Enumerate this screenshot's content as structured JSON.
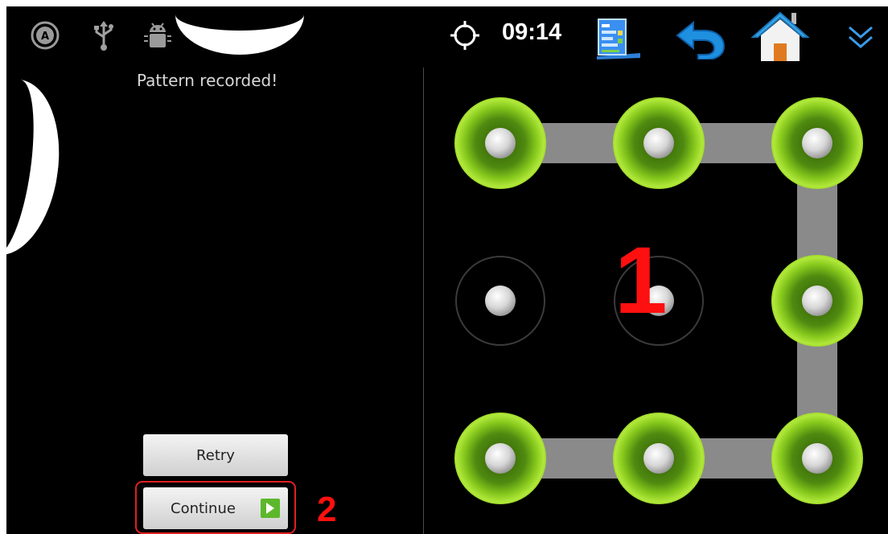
{
  "status_bar": {
    "time": "09:14",
    "icons": [
      "accessibility-icon",
      "usb-icon",
      "android-debug-icon",
      "gps-icon",
      "clock",
      "task-manager-icon",
      "back-icon",
      "home-icon",
      "collapse-icon"
    ]
  },
  "lock_setup": {
    "prompt": "Pattern recorded!",
    "retry_label": "Retry",
    "continue_label": "Continue"
  },
  "pattern": {
    "dots": [
      {
        "id": 1,
        "selected": true
      },
      {
        "id": 2,
        "selected": true
      },
      {
        "id": 3,
        "selected": true
      },
      {
        "id": 4,
        "selected": false
      },
      {
        "id": 5,
        "selected": false
      },
      {
        "id": 6,
        "selected": true
      },
      {
        "id": 7,
        "selected": true
      },
      {
        "id": 8,
        "selected": true
      },
      {
        "id": 9,
        "selected": true
      }
    ],
    "sequence": [
      1,
      2,
      3,
      6,
      9,
      8,
      7
    ]
  },
  "annotations": {
    "step_1": "1",
    "step_2": "2"
  },
  "colors": {
    "background": "#000000",
    "selected_ring": "#7fbf1a",
    "pattern_line": "#8a8a8a",
    "annotation": "#ff1010",
    "back_arrow": "#1f8fe0"
  }
}
